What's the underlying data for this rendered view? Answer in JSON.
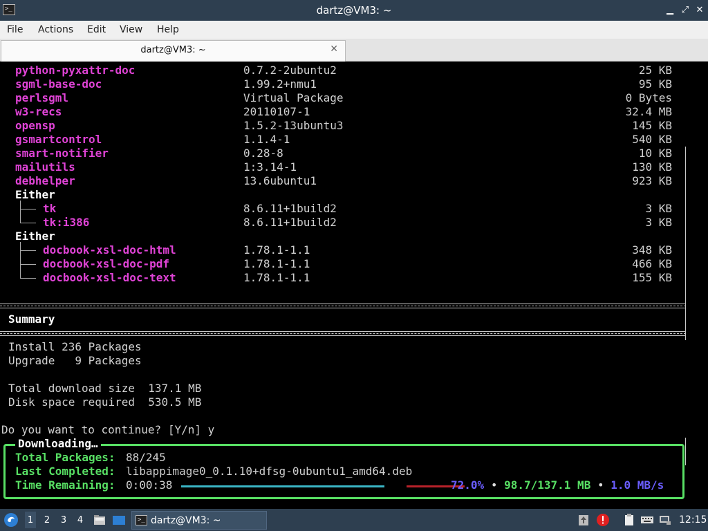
{
  "window": {
    "title": "dartz@VM3: ~"
  },
  "menubar": [
    "File",
    "Actions",
    "Edit",
    "View",
    "Help"
  ],
  "tab": {
    "label": "dartz@VM3: ~"
  },
  "packages": [
    {
      "name": "python-pyxattr-doc",
      "version": "0.7.2-2ubuntu2",
      "size": "25 KB"
    },
    {
      "name": "sgml-base-doc",
      "version": "1.99.2+nmu1",
      "size": "95 KB"
    },
    {
      "name": "perlsgml",
      "version": "Virtual Package",
      "size": "0 Bytes"
    },
    {
      "name": "w3-recs",
      "version": "20110107-1",
      "size": "32.4 MB"
    },
    {
      "name": "opensp",
      "version": "1.5.2-13ubuntu3",
      "size": "145 KB"
    },
    {
      "name": "gsmartcontrol",
      "version": "1.1.4-1",
      "size": "540 KB"
    },
    {
      "name": "smart-notifier",
      "version": "0.28-8",
      "size": "10 KB"
    },
    {
      "name": "mailutils",
      "version": "1:3.14-1",
      "size": "130 KB"
    },
    {
      "name": "debhelper",
      "version": "13.6ubuntu1",
      "size": "923 KB"
    }
  ],
  "either_groups": [
    {
      "label": "Either",
      "items": [
        {
          "name": "tk",
          "version": "8.6.11+1build2",
          "size": "3 KB"
        },
        {
          "name": "tk:i386",
          "version": "8.6.11+1build2",
          "size": "3 KB"
        }
      ]
    },
    {
      "label": "Either",
      "items": [
        {
          "name": "docbook-xsl-doc-html",
          "version": "1.78.1-1.1",
          "size": "348 KB"
        },
        {
          "name": "docbook-xsl-doc-pdf",
          "version": "1.78.1-1.1",
          "size": "466 KB"
        },
        {
          "name": "docbook-xsl-doc-text",
          "version": "1.78.1-1.1",
          "size": "155 KB"
        }
      ]
    }
  ],
  "summary": {
    "heading": "Summary",
    "lines": [
      "Install 236 Packages",
      "Upgrade   9 Packages",
      "",
      "Total download size  137.1 MB",
      "Disk space required  530.5 MB"
    ]
  },
  "prompt": "Do you want to continue? [Y/n] y",
  "download": {
    "title": "Downloading…",
    "total_label": "Total Packages:",
    "total_value": "88/245",
    "last_label": "Last Completed:",
    "last_value": "libappimage0_0.1.10+dfsg-0ubuntu1_amd64.deb",
    "time_label": "Time Remaining:",
    "time_value": "0:00:38",
    "percent_text": "72.0%",
    "progress_fraction": 0.72,
    "downloaded": "98.7/137.1 MB",
    "rate": "1.0 MB/s",
    "bullet": "•"
  },
  "taskbar": {
    "workspaces": [
      "1",
      "2",
      "3",
      "4"
    ],
    "active_workspace": "1",
    "task_label": "dartz@VM3: ~",
    "clock": "12:15"
  },
  "colors": {
    "package": "#e043d6",
    "box_green": "#58e064",
    "percent": "#6a5dfc",
    "panel": "#2e3f50"
  }
}
